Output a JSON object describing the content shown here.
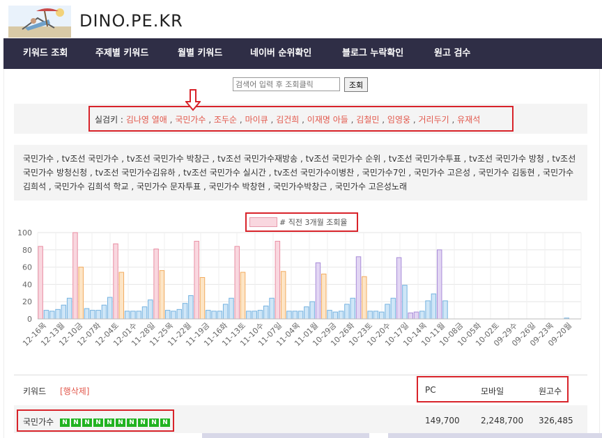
{
  "header": {
    "site_title": "DINO.PE.KR"
  },
  "nav": {
    "items": [
      "키워드 조회",
      "주제별 키워드",
      "월별 키워드",
      "네이버 순위확인",
      "블로그 누락확인",
      "원고 검수"
    ]
  },
  "search": {
    "placeholder": "검색어 입력 후 조회클릭",
    "button_label": "조회"
  },
  "realtime": {
    "label": "실검키 :",
    "keywords": [
      "김나영 열애",
      "국민가수",
      "조두순",
      "마이큐",
      "김건희",
      "이재명 아들",
      "김철민",
      "임영웅",
      "거리두기",
      "유재석"
    ],
    "separator": ","
  },
  "related": {
    "text": "국민가수 , tv조선 국민가수 , tv조선 국민가수 박창근 , tv조선 국민가수재방송 , tv조선 국민가수 순위 , tv조선 국민가수투표 , tv조선 국민가수 방청 , tv조선 국민가수 방청신청 , tv조선 국민가수김유하 , tv조선 국민가수 실시간 , tv조선 국민가수이병찬 , 국민가수7인 , 국민가수 고은성 , 국민가수 김동현 , 국민가수 김희석 , 국민가수 김희석 학교 , 국민가수 문자투표 , 국민가수 박창현 , 국민가수박창근 , 국민가수 고은성노래"
  },
  "legend": {
    "label": "# 직전 3개월 조회율"
  },
  "chart_data": {
    "type": "bar",
    "ylim": [
      0,
      100
    ],
    "yticks": [
      0,
      20,
      40,
      60,
      80,
      100
    ],
    "grid": true,
    "series_colors": {
      "pink": {
        "fill": "#f9d7df",
        "stroke": "#e98ea3"
      },
      "blue": {
        "fill": "#cfe6f7",
        "stroke": "#74b2e0"
      },
      "orange": {
        "fill": "#fde5c6",
        "stroke": "#f2ab60"
      },
      "purple": {
        "fill": "#e2d6f3",
        "stroke": "#a88bd8"
      }
    },
    "categories": [
      "12-16목",
      "12-13월",
      "12-10금",
      "12-07화",
      "12-04토",
      "12-01수",
      "11-28일",
      "11-25목",
      "11-22월",
      "11-19금",
      "11-16화",
      "11-13토",
      "11-10수",
      "11-07일",
      "11-04목",
      "11-01월",
      "10-29금",
      "10-26화",
      "10-23토",
      "10-20수",
      "10-17일",
      "10-14목",
      "10-11월",
      "10-08금",
      "10-05화",
      "10-02토",
      "09-29수",
      "09-26일",
      "09-23목",
      "09-20월"
    ],
    "values": [
      84,
      10,
      9,
      11,
      16,
      24,
      100,
      60,
      12,
      10,
      10,
      16,
      25,
      87,
      54,
      9,
      9,
      9,
      14,
      22,
      81,
      56,
      10,
      9,
      11,
      18,
      27,
      90,
      48,
      10,
      9,
      9,
      17,
      24,
      84,
      54,
      9,
      9,
      10,
      15,
      24,
      90,
      55,
      9,
      9,
      9,
      14,
      20,
      65,
      52,
      10,
      8,
      9,
      17,
      24,
      72,
      49,
      9,
      9,
      8,
      17,
      24,
      71,
      39,
      7,
      8,
      9,
      21,
      29,
      80,
      21,
      0,
      0,
      0,
      0,
      0,
      0,
      0,
      0,
      0,
      0,
      0,
      0,
      0,
      0,
      0,
      0,
      0,
      0,
      0,
      0,
      1,
      0,
      0
    ],
    "bar_colors": [
      "pink",
      "blue",
      "blue",
      "blue",
      "blue",
      "blue",
      "pink",
      "orange",
      "blue",
      "blue",
      "blue",
      "blue",
      "blue",
      "pink",
      "orange",
      "blue",
      "blue",
      "blue",
      "blue",
      "blue",
      "pink",
      "orange",
      "blue",
      "blue",
      "blue",
      "blue",
      "blue",
      "pink",
      "orange",
      "blue",
      "blue",
      "blue",
      "blue",
      "blue",
      "pink",
      "orange",
      "blue",
      "blue",
      "blue",
      "blue",
      "blue",
      "pink",
      "orange",
      "blue",
      "blue",
      "blue",
      "blue",
      "blue",
      "purple",
      "orange",
      "blue",
      "blue",
      "blue",
      "blue",
      "blue",
      "purple",
      "orange",
      "blue",
      "blue",
      "blue",
      "blue",
      "blue",
      "purple",
      "blue",
      "purple",
      "purple",
      "blue",
      "blue",
      "blue",
      "purple",
      "blue",
      "blue",
      "blue",
      "blue",
      "blue",
      "blue",
      "blue",
      "blue",
      "blue",
      "blue",
      "blue",
      "blue",
      "blue",
      "blue",
      "blue",
      "blue",
      "blue",
      "blue",
      "blue",
      "blue",
      "blue",
      "blue",
      "blue",
      "blue"
    ]
  },
  "table": {
    "headers": {
      "keyword": "키워드",
      "delete": "[행삭제]",
      "pc": "PC",
      "mobile": "모바일",
      "docs": "원고수"
    },
    "rows": [
      {
        "keyword": "국민가수",
        "badge": "N",
        "badge_count": 10,
        "pc": "149,700",
        "mobile": "2,248,700",
        "docs": "326,485"
      }
    ]
  }
}
